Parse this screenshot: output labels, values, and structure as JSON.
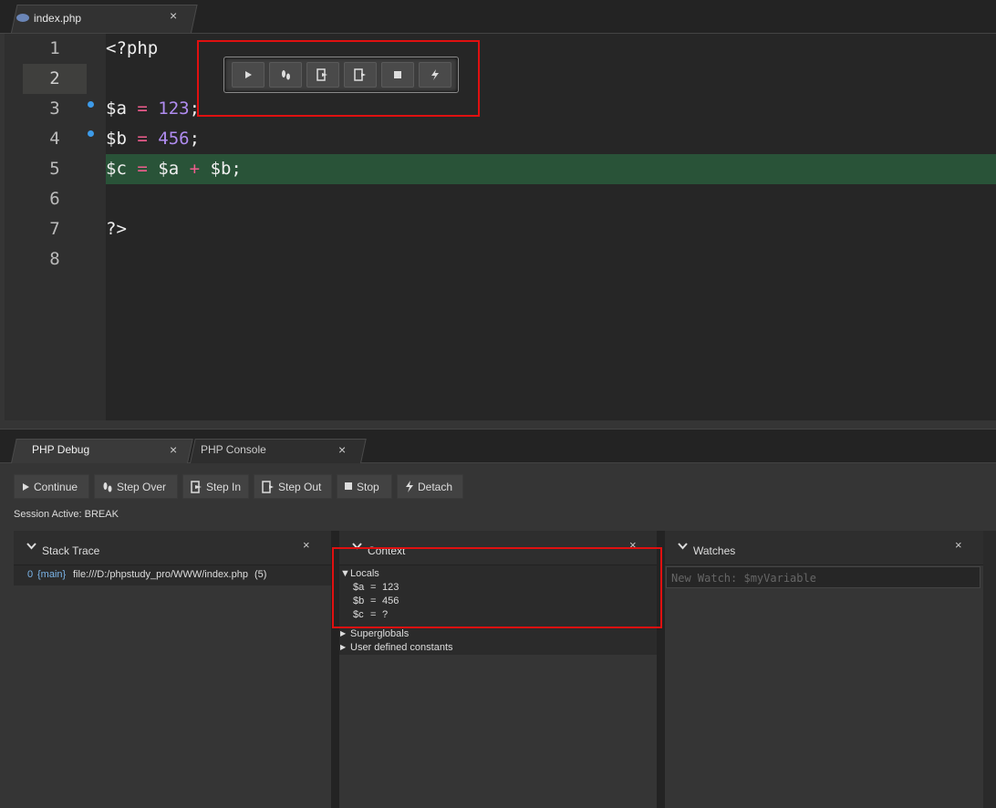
{
  "editor_tab": {
    "label": "index.php",
    "close": "×"
  },
  "code": {
    "line_numbers": [
      "1",
      "2",
      "3",
      "4",
      "5",
      "6",
      "7",
      "8"
    ],
    "line1": "<?php",
    "line3": {
      "var": "$a",
      "op": "=",
      "num": "123",
      "end": ";"
    },
    "line4": {
      "var": "$b",
      "op": "=",
      "num": "456",
      "end": ";"
    },
    "line5": {
      "var1": "$c",
      "op1": "=",
      "var2": "$a",
      "op2": "+",
      "var3": "$b",
      "end": ";"
    },
    "line7": "?>",
    "active_line": 2,
    "current_line": 5,
    "breakpoints": [
      3,
      4
    ]
  },
  "floating_toolbar": {
    "buttons": [
      "continue-icon",
      "step-over-icon",
      "step-in-icon",
      "step-out-icon",
      "stop-icon",
      "detach-icon"
    ]
  },
  "panel_tabs": [
    {
      "label": "PHP Debug",
      "close": "×"
    },
    {
      "label": "PHP Console",
      "close": "×"
    }
  ],
  "debug_toolbar": {
    "continue": "Continue",
    "step_over": "Step Over",
    "step_in": "Step In",
    "step_out": "Step Out",
    "stop": "Stop",
    "detach": "Detach"
  },
  "session_status": "Session Active: BREAK",
  "stack_trace": {
    "title": "Stack Trace",
    "close": "×",
    "rows": [
      {
        "index": "0",
        "fn": "{main}",
        "file": "file:///D:/phpstudy_pro/WWW/index.php",
        "line": "(5)"
      }
    ]
  },
  "context": {
    "title": "Context",
    "close": "×",
    "locals_label": "Locals",
    "locals": [
      {
        "name": "$a",
        "eq": "=",
        "value": "123"
      },
      {
        "name": "$b",
        "eq": "=",
        "value": "456"
      },
      {
        "name": "$c",
        "eq": "=",
        "value": "?"
      }
    ],
    "superglobals": "Superglobals",
    "constants": "User defined constants"
  },
  "watches": {
    "title": "Watches",
    "close": "×",
    "placeholder": "New Watch: $myVariable"
  },
  "colors": {
    "accent_red": "#e01010",
    "current_line": "#295338",
    "operator": "#f05d8e",
    "number": "#b08cf0",
    "breakpoint": "#3d9be9"
  }
}
